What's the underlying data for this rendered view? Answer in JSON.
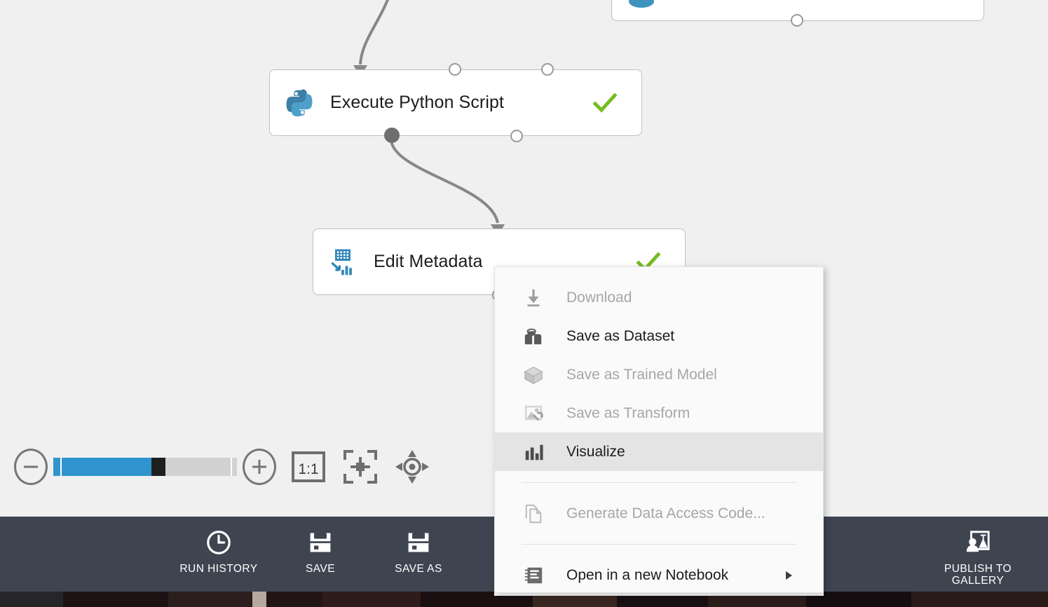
{
  "canvas": {
    "background_color": "#f0f0f0",
    "nodes": [
      {
        "id": "partial-node-top",
        "label": "",
        "icon": "module-icon",
        "status": ""
      },
      {
        "id": "execute-python-script",
        "label": "Execute Python Script",
        "icon": "python-icon",
        "status": "check"
      },
      {
        "id": "edit-metadata",
        "label": "Edit Metadata",
        "icon": "edit-metadata-icon",
        "status": "check"
      }
    ]
  },
  "zoom_controls": {
    "zoom_out_label": "−",
    "zoom_in_label": "+",
    "slider_fill_percent": 52,
    "actual_size_label": "1:1",
    "fit_to_window_name": "fit-to-window-icon",
    "pan_name": "pan-icon",
    "fill_color": "#2f94ce",
    "thumb_color": "#1f1f1f",
    "track_color": "#d2d2d2"
  },
  "toolbar": {
    "background_color": "#3e4551",
    "buttons": [
      {
        "id": "run-history",
        "label": "RUN HISTORY",
        "icon": "clock-icon"
      },
      {
        "id": "save",
        "label": "SAVE",
        "icon": "floppy-disk-icon"
      },
      {
        "id": "save-as",
        "label": "SAVE AS",
        "icon": "floppy-disk-icon"
      },
      {
        "id": "publish-to-gallery",
        "label": "PUBLISH TO\nGALLERY",
        "icon": "publish-gallery-icon"
      }
    ]
  },
  "context_menu": {
    "background_color": "#fafafa",
    "highlight_color": "#e4e4e4",
    "items": [
      {
        "id": "download",
        "label": "Download",
        "icon": "download-icon",
        "disabled": true,
        "highlighted": false,
        "submenu": false
      },
      {
        "id": "save-as-dataset",
        "label": "Save as Dataset",
        "icon": "dataset-icon",
        "disabled": false,
        "highlighted": false,
        "submenu": false
      },
      {
        "id": "save-as-trained-model",
        "label": "Save as Trained Model",
        "icon": "cube-icon",
        "disabled": true,
        "highlighted": false,
        "submenu": false
      },
      {
        "id": "save-as-transform",
        "label": "Save as Transform",
        "icon": "transform-icon",
        "disabled": true,
        "highlighted": false,
        "submenu": false
      },
      {
        "id": "visualize",
        "label": "Visualize",
        "icon": "bar-chart-icon",
        "disabled": false,
        "highlighted": true,
        "submenu": false
      },
      {
        "id": "generate-data-access-code",
        "label": "Generate Data Access Code...",
        "icon": "copy-page-icon",
        "disabled": true,
        "highlighted": false,
        "submenu": false
      },
      {
        "id": "open-in-a-new-notebook",
        "label": "Open in a new Notebook",
        "icon": "notebook-icon",
        "disabled": false,
        "highlighted": false,
        "submenu": true
      }
    ]
  }
}
